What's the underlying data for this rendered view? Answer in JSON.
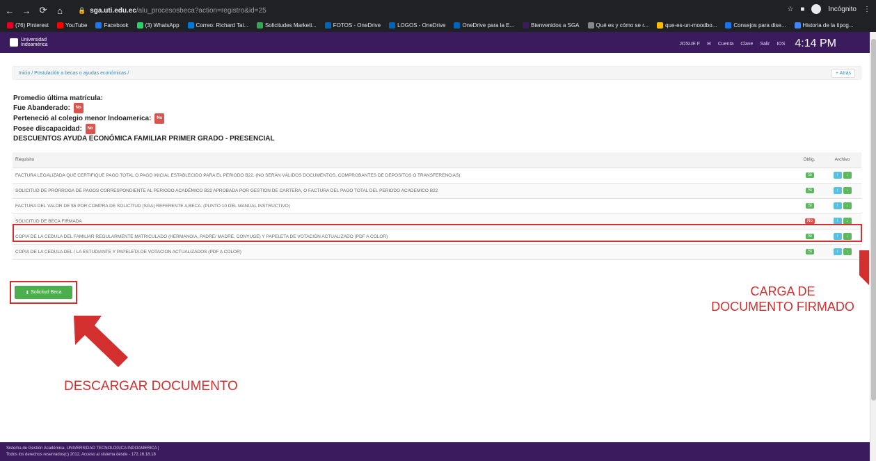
{
  "browser": {
    "url_host": "sga.uti.edu.ec",
    "url_path": "/alu_procesosbeca?action=registro&id=25",
    "incognito_label": "Incógnito",
    "bookmarks": [
      {
        "label": "(76) Pinterest",
        "color": "#e60023"
      },
      {
        "label": "YouTube",
        "color": "#ff0000"
      },
      {
        "label": "Facebook",
        "color": "#1877f2"
      },
      {
        "label": "(3) WhatsApp",
        "color": "#25d366"
      },
      {
        "label": "Correo: Richard Tai...",
        "color": "#0078d4"
      },
      {
        "label": "Solicitudes Marketi...",
        "color": "#34a853"
      },
      {
        "label": "FOTOS - OneDrive",
        "color": "#0364b8"
      },
      {
        "label": "LOGOS - OneDrive",
        "color": "#0364b8"
      },
      {
        "label": "OneDrive para la E...",
        "color": "#0364b8"
      },
      {
        "label": "Bienvenidos a SGA",
        "color": "#3b1a5e"
      },
      {
        "label": "Qué es y cómo se r...",
        "color": "#888888"
      },
      {
        "label": "que-es-un-moodbo...",
        "color": "#fbbc04"
      },
      {
        "label": "Consejos para dise...",
        "color": "#1a73e8"
      },
      {
        "label": "Historia de la tipog...",
        "color": "#4285f4"
      }
    ]
  },
  "header": {
    "logo_line1": "Universidad",
    "logo_line2": "Indoamérica",
    "user": "JOSUE F",
    "cuenta": "Cuenta",
    "clave": "Clave",
    "salir": "Salir",
    "ios": "IOS",
    "time": "4:14 PM"
  },
  "breadcrumb": {
    "path": "Inicio / Postulación a becas o ayudas económicas /",
    "back": "+ Atrás"
  },
  "info": {
    "promedio": "Promedio última matrícula:",
    "abanderado": "Fue Abanderado:",
    "colegio": "Perteneció al colegio menor Indoamerica:",
    "discapacidad": "Posee discapacidad:",
    "badge_no": "No"
  },
  "section_title": "DESCUENTOS AYUDA ECONÓMICA FAMILIAR PRIMER GRADO - PRESENCIAL",
  "table": {
    "headers": {
      "requisito": "Requisito",
      "oblig": "Oblig.",
      "archivo": "Archivo"
    },
    "rows": [
      {
        "text": "FACTURA LEGALIZADA QUE CERTIFIQUE PAGO TOTAL O PAGO INICIAL ESTABLECIDO PARA EL PERIODO B22. (NO SERÁN VÁLIDOS DOCUMENTOS, COMPROBANTES DE DEPOSITOS O TRANSFERENCIAS)",
        "oblig": "Si"
      },
      {
        "text": "SOLICITUD DE PRÓRROGA DE PAGOS CORRESPONDIENTE AL PERIODO ACADÉMICO B22 APROBADA POR GESTION DE CARTERA, O FACTURA DEL PAGO TOTAL DEL PERIODO ACADEMICO B22",
        "oblig": "Si"
      },
      {
        "text": "FACTURA DEL VALOR DE $5 POR COMPRA DE SOLICITUD (SGA) REFERENTE A BECA. (PUNTO 10 DEL MANUAL INSTRUCTIVO)",
        "oblig": "Si"
      },
      {
        "text": "SOLICITUD DE BECA FIRMADA",
        "oblig": "No"
      },
      {
        "text": "COPIA DE LA CEDULA DEL FAMILIAR REGULARMENTE MATRICULADO (HERMANO/A, PADRE/ MADRE, CONYUGE) Y PAPELETA DE VOTACIÓN ACTUALIZADO (PDF A COLOR)",
        "oblig": "Si"
      },
      {
        "text": "COPIA DE LA CEDULA DEL / LA ESTUDIANTE Y PAPELETA DE VOTACION ACTUALIZADOS (PDF A COLOR)",
        "oblig": "Si"
      }
    ]
  },
  "solicitud_button": "Solicitud Beca",
  "annotations": {
    "carga_line1": "CARGA DE",
    "carga_line2": "DOCUMENTO FIRMADO",
    "descargar": "DESCARGAR DOCUMENTO"
  },
  "footer": {
    "line1": "Sistema de Gestión Académica, UNIVERSIDAD TECNOLOGICA INDOAMERICA |",
    "line2": "Todos los derechos reservados(c) 2012, Acceso al sistema desde - 172.16.18.18"
  }
}
